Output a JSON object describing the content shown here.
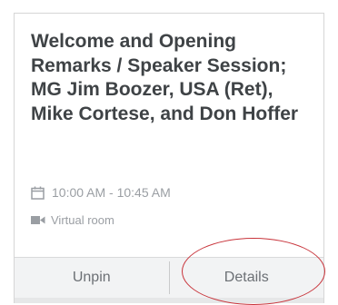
{
  "session": {
    "title": "Welcome and Opening Remarks / Speaker Session; MG Jim Boozer, USA (Ret), Mike Cortese, and Don Hoffer",
    "time": "10:00 AM - 10:45 AM",
    "room": "Virtual room"
  },
  "actions": {
    "unpin_label": "Unpin",
    "details_label": "Details"
  },
  "icons": {
    "time": "calendar-icon",
    "room": "video-camera-icon"
  },
  "colors": {
    "title_text": "#3f4346",
    "meta_text": "#9a9ea3",
    "button_text": "#6c7075",
    "action_bar": "#f2f3f4",
    "highlight_circle": "#c8333a"
  }
}
